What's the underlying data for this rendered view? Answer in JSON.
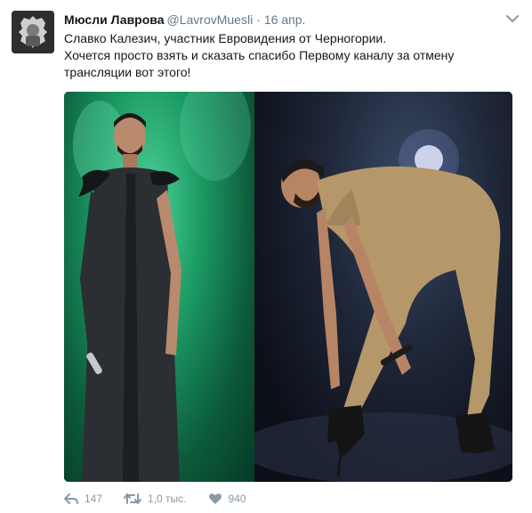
{
  "tweet": {
    "display_name": "Мюсли Лаврова",
    "username": "@LavrovMuesli",
    "separator": "·",
    "timestamp": "16 апр.",
    "text_line1": "Славко Калезич, участник Евровидения от Черногории.",
    "text_line2": "Хочется просто взять и сказать спасибо Первому каналу за отмену трансляции вот этого!"
  },
  "actions": {
    "reply_count": "147",
    "retweet_count": "1,0 тыс.",
    "like_count": "940"
  },
  "icons": {
    "reply": "reply-icon",
    "retweet": "retweet-icon",
    "like": "heart-icon",
    "more": "chevron-down-icon"
  },
  "colors": {
    "text": "#14171a",
    "secondary": "#657786",
    "action": "#8899a6",
    "stage_green": "#1c9a64"
  }
}
